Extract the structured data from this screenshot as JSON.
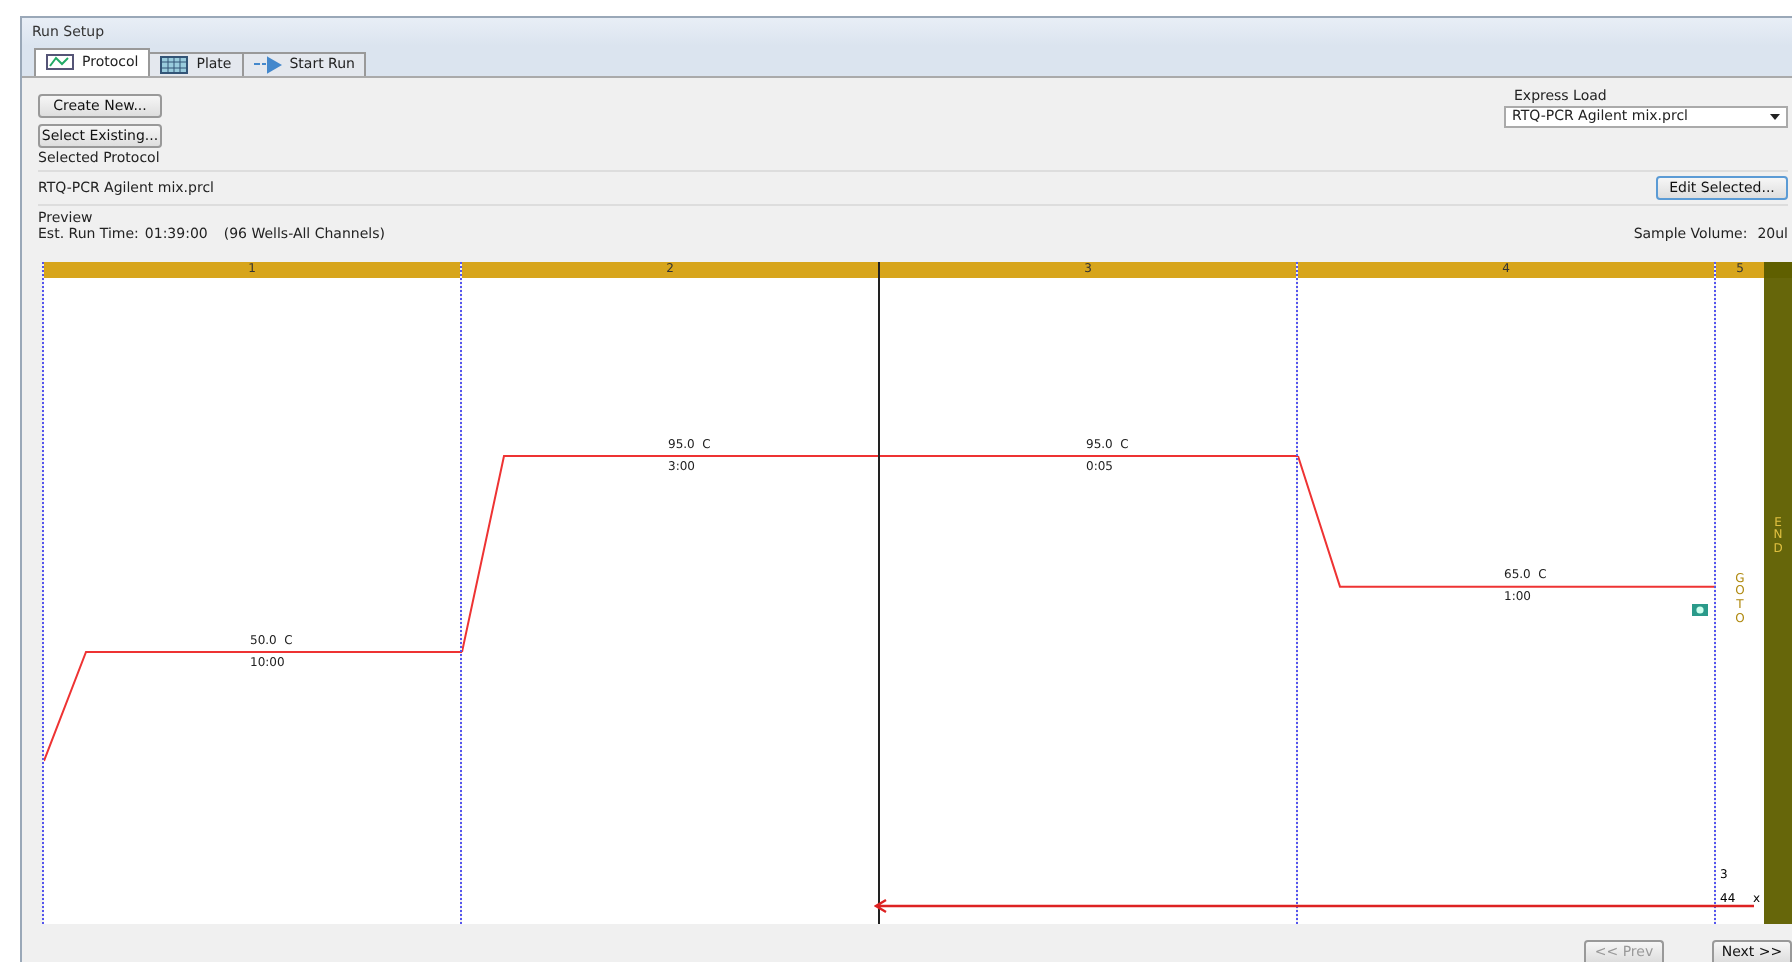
{
  "window": {
    "title": "Run Setup"
  },
  "tabs": [
    {
      "label": "Protocol",
      "selected": true
    },
    {
      "label": "Plate",
      "selected": false
    },
    {
      "label": "Start Run",
      "selected": false
    }
  ],
  "actions": [
    "Create New...",
    "Select Existing..."
  ],
  "express_load": {
    "label": "Express Load",
    "value": "RTQ-PCR Agilent mix.prcl"
  },
  "selected_protocol": {
    "label": "Selected Protocol",
    "value": "RTQ-PCR Agilent mix.prcl",
    "button": "Edit Selected..."
  },
  "preview": {
    "label": "Preview",
    "run_time_label": "Est. Run Time:",
    "run_time": "01:39:00",
    "wells": "(96 Wells-All Channels)",
    "sample_volume_label": "Sample Volume:",
    "sample_volume": "20ul"
  },
  "steps": [
    {
      "number": "1",
      "temperature": "50.0",
      "unit": "C",
      "time": "10:00",
      "loop_start": false,
      "camera": false
    },
    {
      "number": "2",
      "temperature": "95.0",
      "unit": "C",
      "time": "3:00",
      "loop_start": false,
      "camera": false
    },
    {
      "number": "3",
      "temperature": "95.0",
      "unit": "C",
      "time": "0:05",
      "loop_start": true,
      "camera": false
    },
    {
      "number": "4",
      "temperature": "65.0",
      "unit": "C",
      "time": "1:00",
      "loop_start": false,
      "camera": true
    }
  ],
  "goto": {
    "number": "5",
    "label": "GOTO",
    "target": "3",
    "repeats": "44",
    "times": "x"
  },
  "end": {
    "label": "END"
  },
  "nav": [
    {
      "label": "<< Prev",
      "disabled": true
    },
    {
      "label": "Next >>",
      "disabled": false
    }
  ]
}
